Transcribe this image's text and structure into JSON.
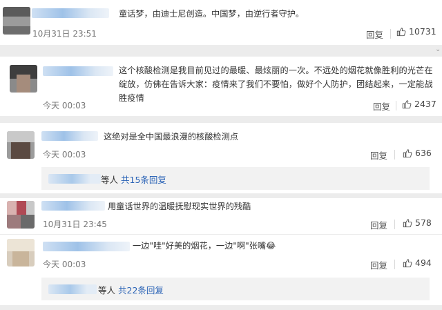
{
  "comments": [
    {
      "text": "童话梦，由迪士尼创造。中国梦，由逆行者守护。",
      "time": "10月31日 23:51",
      "reply_label": "回复",
      "likes": "10731"
    },
    {
      "text": "这个核酸检测是我目前见过的最暖、最炫丽的一次。不远处的烟花就像胜利的光芒在绽放，仿佛在告诉大家：疫情来了我们不要怕，做好个人防护，团结起来，一定能战胜疫情",
      "time": "今天 00:03",
      "reply_label": "回复",
      "likes": "2437"
    },
    {
      "text": "这绝对是全中国最浪漫的核酸检测点",
      "time": "今天 00:03",
      "reply_label": "回复",
      "likes": "636",
      "sub_replies": {
        "suffix": "等人",
        "link": "共15条回复"
      }
    },
    {
      "text": "用童话世界的温暖抚慰现实世界的残酷",
      "time": "10月31日 23:45",
      "reply_label": "回复",
      "likes": "578"
    },
    {
      "text": "一边\"哇\"好美的烟花，一边\"啊\"张嘴😂",
      "time": "今天 00:03",
      "reply_label": "回复",
      "likes": "494",
      "sub_replies": {
        "suffix": "等人",
        "link": "共22条回复"
      }
    }
  ],
  "icons": {
    "like": "thumbs-up-icon"
  },
  "colors": {
    "link": "#2a63b6",
    "background": "#ececec",
    "card": "#ffffff"
  }
}
